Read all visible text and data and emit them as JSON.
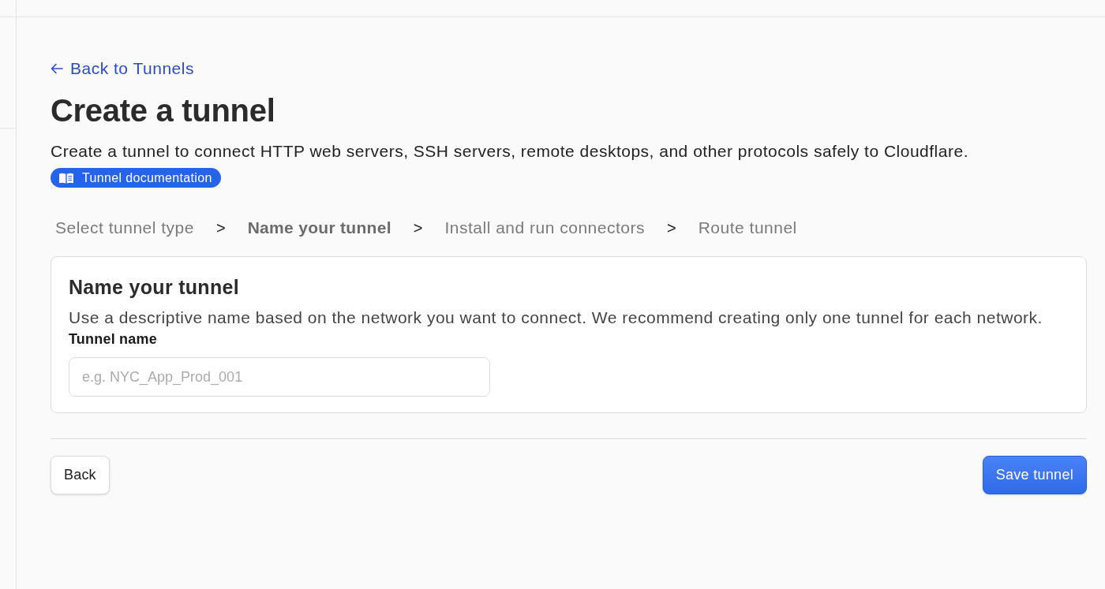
{
  "back_link": {
    "label": "Back to Tunnels"
  },
  "title": "Create a tunnel",
  "description": "Create a tunnel to connect HTTP web servers, SSH servers, remote desktops, and other protocols safely to Cloudflare.",
  "doc_badge": {
    "label": "Tunnel documentation"
  },
  "steps": [
    {
      "label": "Select tunnel type",
      "selected": false
    },
    {
      "label": "Name your tunnel",
      "selected": true
    },
    {
      "label": "Install and run connectors",
      "selected": false
    },
    {
      "label": "Route tunnel",
      "selected": false
    }
  ],
  "step_separator": ">",
  "card": {
    "heading": "Name your tunnel",
    "description": "Use a descriptive name based on the network you want to connect. We recommend creating only one tunnel for each network.",
    "field": {
      "label": "Tunnel name",
      "placeholder": "e.g. NYC_App_Prod_001"
    }
  },
  "buttons": [
    {
      "label": "Back",
      "kind": "secondary"
    },
    {
      "label": "Save tunnel",
      "kind": "primary"
    }
  ]
}
